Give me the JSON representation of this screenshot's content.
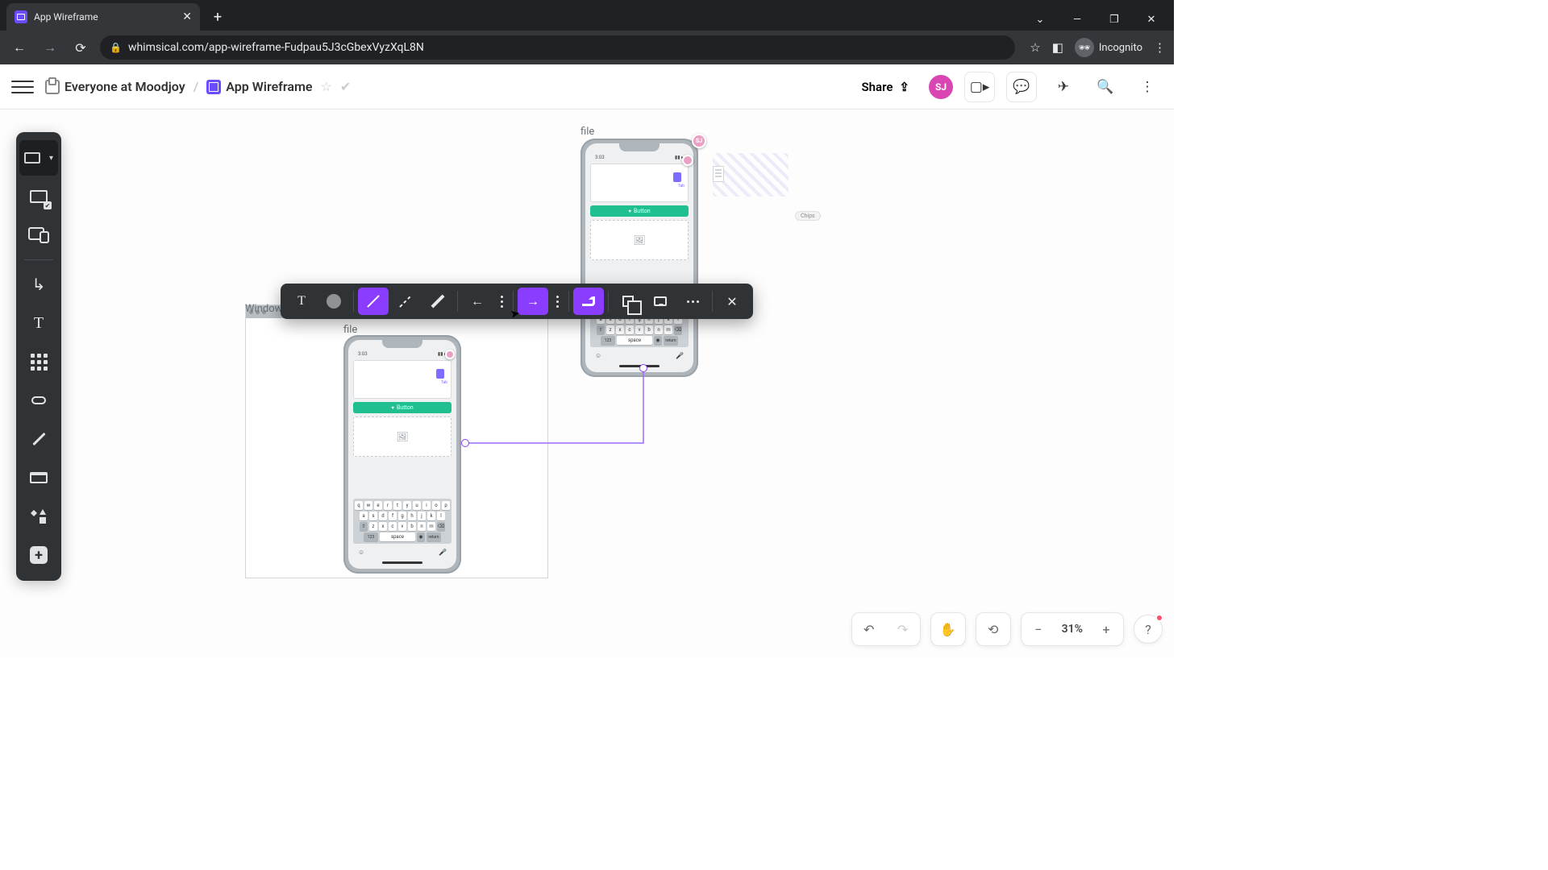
{
  "browser": {
    "tab_title": "App Wireframe",
    "url": "whimsical.com/app-wireframe-Fudpau5J3cGbexVyzXqL8N",
    "incognito_label": "Incognito"
  },
  "header": {
    "workspace": "Everyone at Moodjoy",
    "file": "App Wireframe",
    "share_label": "Share",
    "avatar_initials": "SJ"
  },
  "canvas": {
    "window_label": "Window",
    "phone1_label": "file",
    "phone2_label": "file",
    "button_label": "Button",
    "chips_label": "Chips",
    "phone_time": "3:03",
    "card_tag_text": "Tab",
    "collaborator_initials": "SJ",
    "keyboard": {
      "row1": [
        "q",
        "w",
        "e",
        "r",
        "t",
        "y",
        "u",
        "i",
        "o",
        "p"
      ],
      "row2": [
        "a",
        "s",
        "d",
        "f",
        "g",
        "h",
        "j",
        "k",
        "l"
      ],
      "row3_shift": "⇧",
      "row3": [
        "z",
        "x",
        "c",
        "v",
        "b",
        "n",
        "m"
      ],
      "row3_del": "⌫",
      "row4_123": "123",
      "row4_emoji": "☺",
      "row4_space": "space",
      "row4_mic": "◉",
      "row4_return": "return"
    }
  },
  "zoom": {
    "value": "31%"
  }
}
